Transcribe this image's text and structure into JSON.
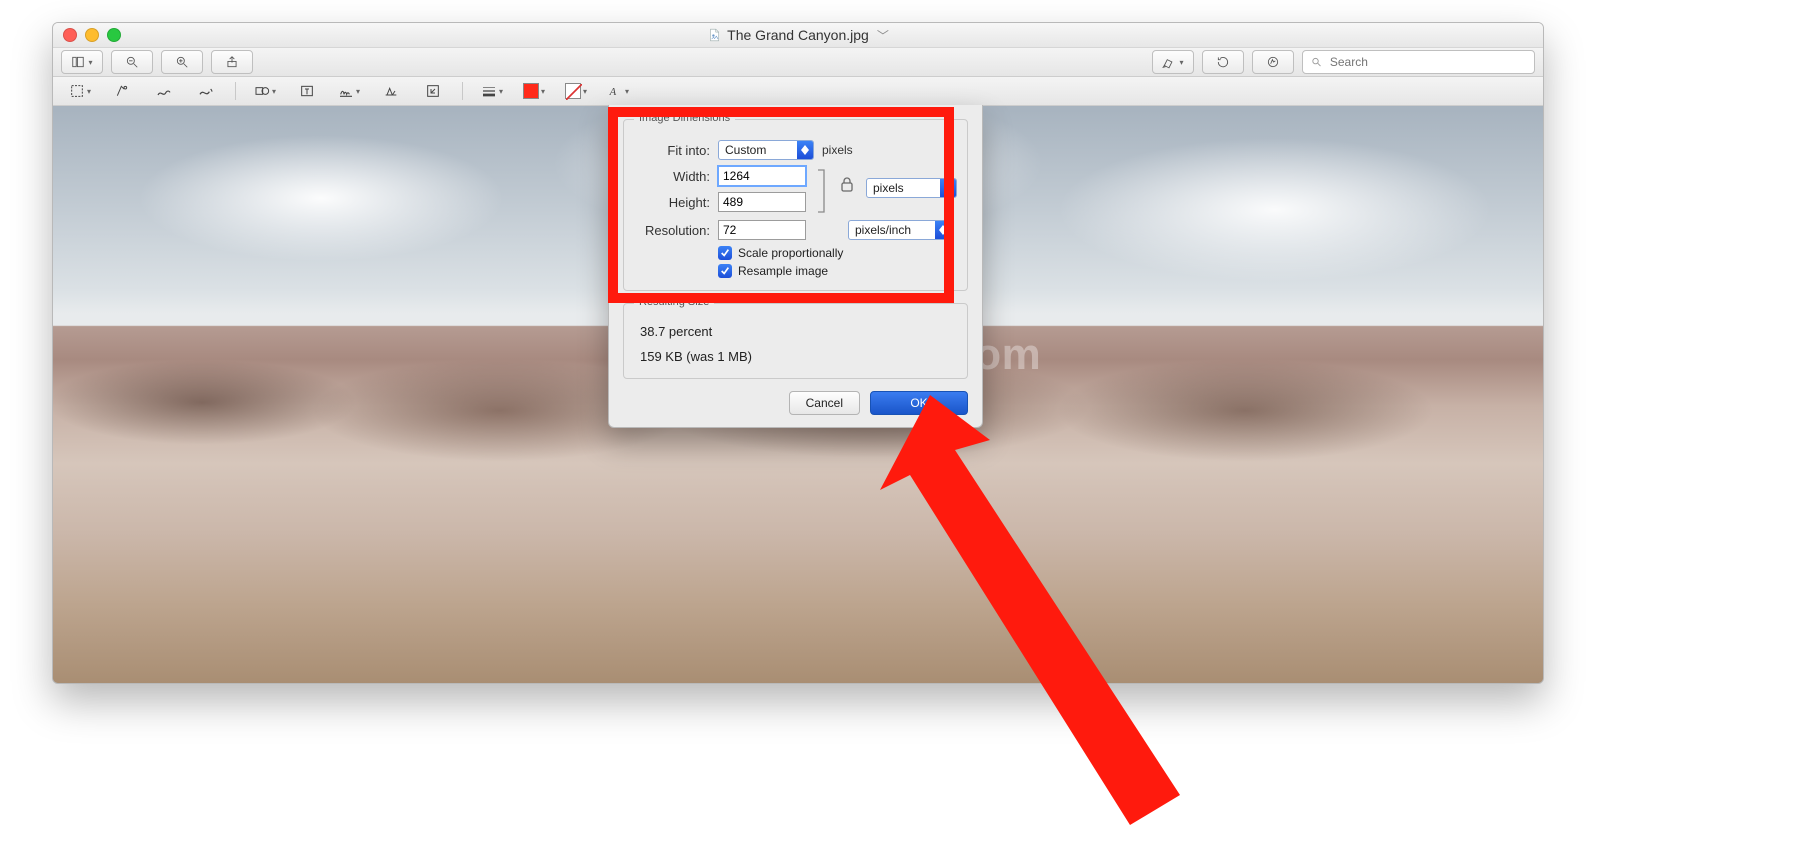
{
  "window": {
    "title": "The Grand Canyon.jpg"
  },
  "toolbar": {
    "search_placeholder": "Search"
  },
  "dialog": {
    "group_dimensions_title": "Image Dimensions",
    "fit_into_label": "Fit into:",
    "fit_into_value": "Custom",
    "fit_into_unit": "pixels",
    "width_label": "Width:",
    "width_value": "1264",
    "height_label": "Height:",
    "height_value": "489",
    "wh_unit_value": "pixels",
    "resolution_label": "Resolution:",
    "resolution_value": "72",
    "resolution_unit_value": "pixels/inch",
    "scale_label": "Scale proportionally",
    "resample_label": "Resample image",
    "group_result_title": "Resulting Size",
    "result_percent": "38.7 percent",
    "result_size": "159 KB (was 1 MB)",
    "cancel_label": "Cancel",
    "ok_label": "OK"
  },
  "watermark": "osxdaily.com"
}
